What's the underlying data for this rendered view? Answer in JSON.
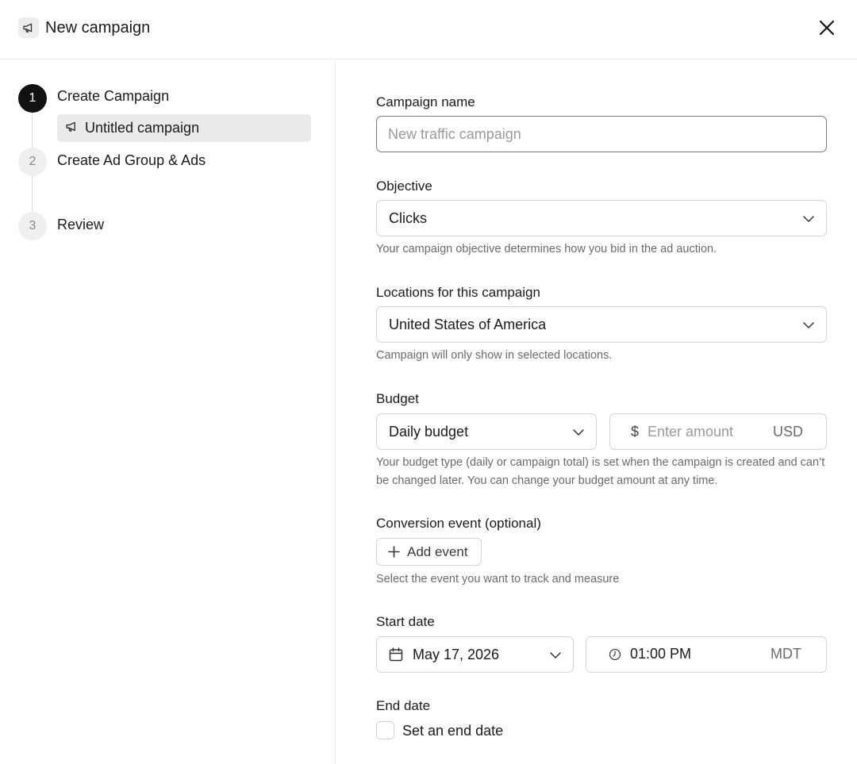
{
  "header": {
    "title": "New campaign",
    "icon": "megaphone-icon",
    "close_icon": "close-icon"
  },
  "steps": [
    {
      "number": "1",
      "label": "Create Campaign",
      "state": "active"
    },
    {
      "number": "2",
      "label": "Create Ad Group & Ads",
      "state": "inactive"
    },
    {
      "number": "3",
      "label": "Review",
      "state": "inactive"
    }
  ],
  "sidebar_sub_item": {
    "label": "Untitled campaign",
    "icon": "megaphone-icon"
  },
  "form": {
    "campaign_name": {
      "label": "Campaign name",
      "value": "",
      "placeholder": "New traffic campaign"
    },
    "objective": {
      "label": "Objective",
      "value": "Clicks",
      "help": "Your campaign objective determines how you bid in the ad auction."
    },
    "locations": {
      "label": "Locations for this campaign",
      "value": "United States of America",
      "help": "Campaign will only show in selected locations."
    },
    "budget": {
      "label": "Budget",
      "type_value": "Daily budget",
      "currency_symbol": "$",
      "amount_value": "",
      "amount_placeholder": "Enter amount",
      "currency": "USD",
      "help": "Your budget type (daily or campaign total) is set when the campaign is created and can’t be changed later. You can change your budget amount at any time."
    },
    "conversion_event": {
      "label": "Conversion event (optional)",
      "button_label": "Add event",
      "help": "Select the event you want to track and measure"
    },
    "start_date": {
      "label": "Start date",
      "date": "May 17, 2026",
      "time": "01:00 PM",
      "timezone": "MDT"
    },
    "end_date": {
      "label": "End date",
      "checkbox_label": "Set an end date",
      "checked": false
    }
  },
  "colors": {
    "text": "#1a1a1a",
    "muted": "#6b6b6b",
    "placeholder": "#9a9a9a",
    "border": "#d4d4d4",
    "active_step": "#111111",
    "sub_item_bg": "#ebebeb"
  }
}
